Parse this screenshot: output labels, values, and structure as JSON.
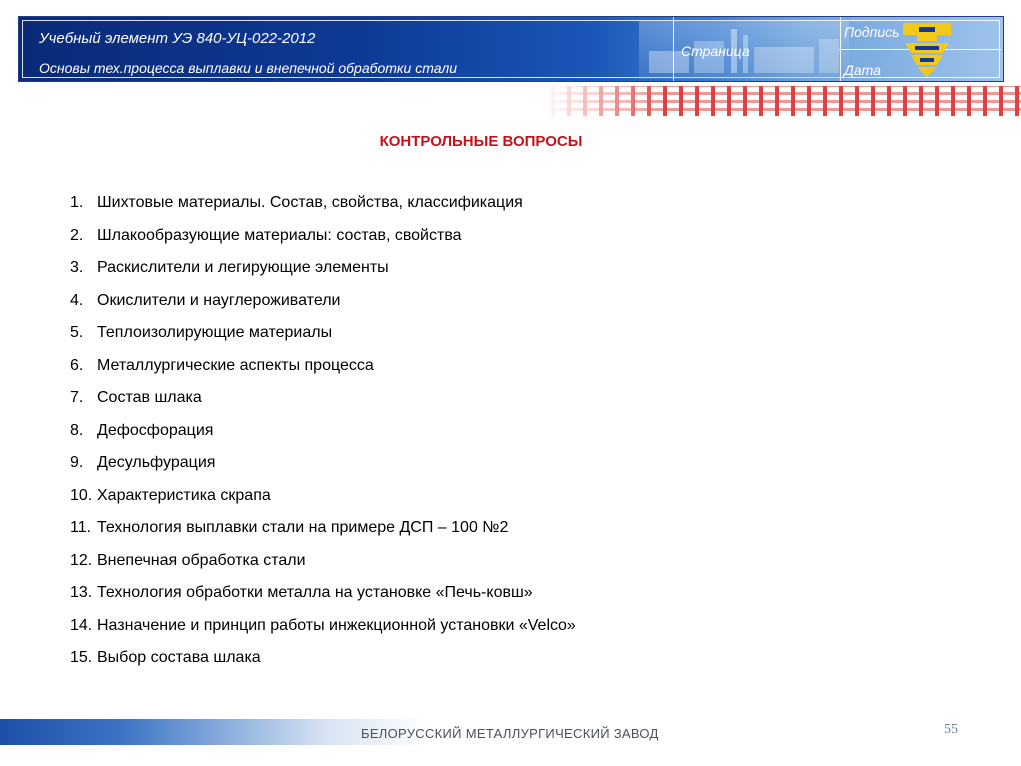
{
  "header": {
    "line1": "Учебный элемент УЭ 840-УЦ-022-2012",
    "line2": "Основы тех.процесса выплавки и внепечной обработки стали",
    "page_label": "Страница",
    "sign_label": "Подпись",
    "date_label": "Дата",
    "colors": {
      "dark": "#0a2a78",
      "light": "#9fc3ea"
    }
  },
  "title": "КОНТРОЛЬНЫЕ ВОПРОСЫ",
  "questions": [
    {
      "num": "1.",
      "text": "Шихтовые материалы. Состав, свойства, классификация"
    },
    {
      "num": "2.",
      "text": "Шлакообразующие материалы: состав, свойства"
    },
    {
      "num": "3.",
      "text": "Раскислители и легирующие элементы"
    },
    {
      "num": "4.",
      "text": "Окислители и науглероживатели"
    },
    {
      "num": "5.",
      "text": "Теплоизолирующие материалы"
    },
    {
      "num": "6.",
      "text": "Металлургические аспекты процесса"
    },
    {
      "num": "7.",
      "text": "Состав шлака"
    },
    {
      "num": "8.",
      "text": "Дефосфорация"
    },
    {
      "num": "9.",
      "text": "Десульфурация"
    },
    {
      "num": "10.",
      "text": "Характеристика скрапа"
    },
    {
      "num": "11.",
      "text": "Технология выплавки стали на примере ДСП – 100 №2"
    },
    {
      "num": "12.",
      "text": "Внепечная обработка стали"
    },
    {
      "num": "13.",
      "text": "Технология обработки металла на установке «Печь-ковш»"
    },
    {
      "num": "14.",
      "text": "Назначение и принцип работы инжекционной установки «Velco»"
    },
    {
      "num": "15.",
      "text": "Выбор состава шлака"
    }
  ],
  "footer": {
    "company": "БЕЛОРУССКИЙ МЕТАЛЛУРГИЧЕСКИЙ ЗАВОД",
    "page_number": "55"
  },
  "accent_color": "#c0141a"
}
